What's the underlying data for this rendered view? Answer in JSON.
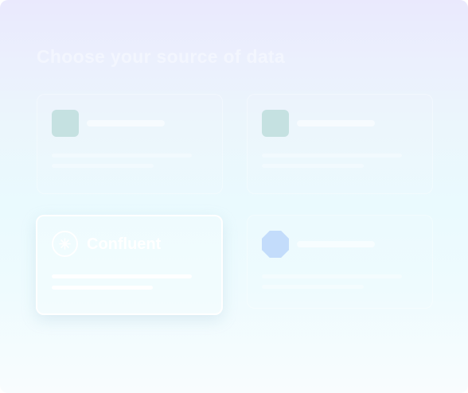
{
  "page": {
    "title": "Choose your source of data"
  },
  "sources": [
    {
      "name": "",
      "icon": "teal-square-icon",
      "selected": false
    },
    {
      "name": "",
      "icon": "teal-square-icon",
      "selected": false
    },
    {
      "name": "Confluent",
      "icon": "confluent-logo-icon",
      "selected": true
    },
    {
      "name": "",
      "icon": "blue-octagon-icon",
      "selected": false
    }
  ],
  "colors": {
    "accent_teal": "#c5e1e1",
    "accent_blue": "#c3dcfb",
    "background_top": "#eae9fd",
    "background_bottom": "#f8fcfe"
  }
}
